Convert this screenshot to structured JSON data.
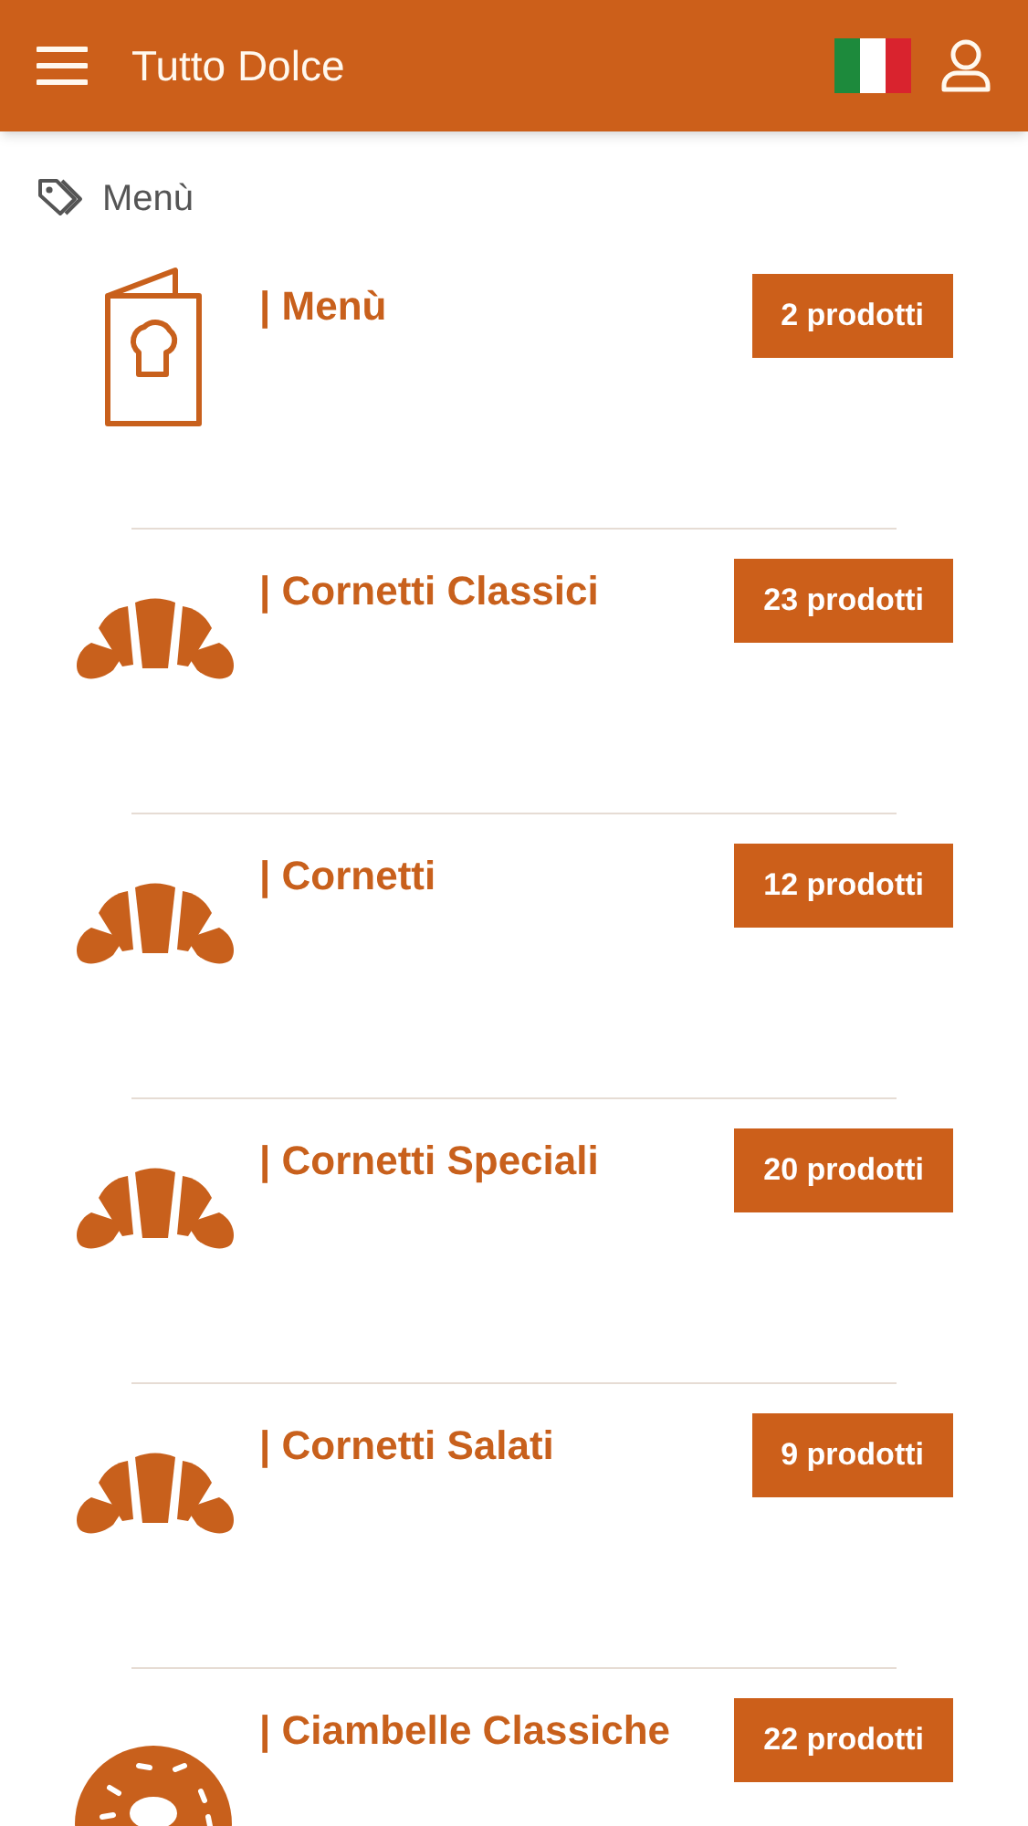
{
  "header": {
    "title": "Tutto Dolce"
  },
  "breadcrumb": {
    "label": "Menù"
  },
  "categories": [
    {
      "kind": "menu",
      "title": "| Menù",
      "count": "2 prodotti"
    },
    {
      "kind": "croissant",
      "title": "| Cornetti Classici",
      "count": "23 prodotti"
    },
    {
      "kind": "croissant",
      "title": "| Cornetti",
      "count": "12 prodotti"
    },
    {
      "kind": "croissant",
      "title": "| Cornetti Speciali",
      "count": "20 prodotti"
    },
    {
      "kind": "croissant",
      "title": "| Cornetti Salati",
      "count": "9 prodotti"
    },
    {
      "kind": "donut",
      "title": "| Ciambelle Classiche",
      "count": "22 prodotti"
    }
  ]
}
